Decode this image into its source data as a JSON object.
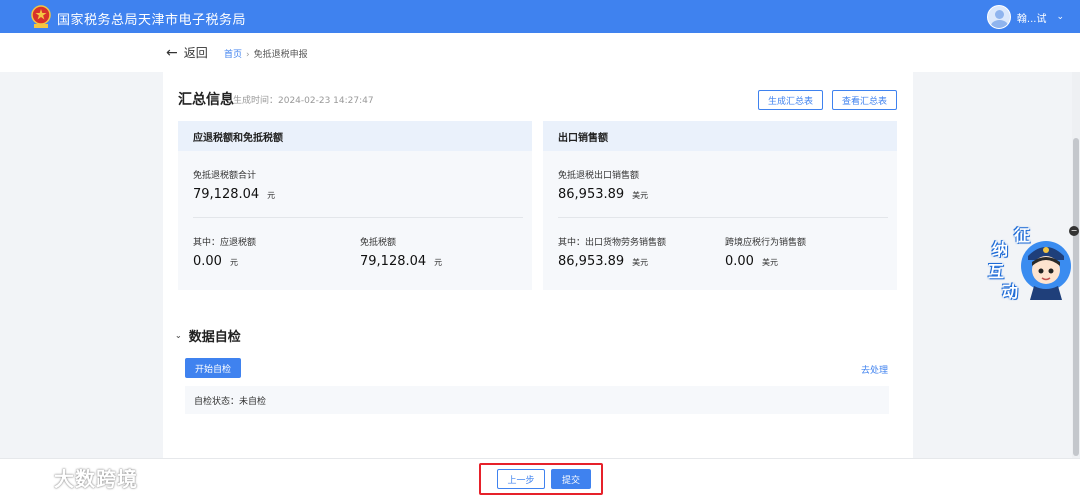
{
  "header": {
    "title": "国家税务总局天津市电子税务局",
    "user_name": "翰...试",
    "caret": "⌄"
  },
  "breadcrumb": {
    "back_label": "返回",
    "back_icon": "←",
    "home": "首页",
    "separator": "›",
    "current": "免抵退税申报"
  },
  "summary": {
    "title": "汇总信息",
    "generated_time": "生成时间：2024-02-23 14:27:47",
    "generate_button": "生成汇总表",
    "view_button": "查看汇总表",
    "left_card": {
      "title": "应退税额和免抵税额",
      "total_label": "免抵退税额合计",
      "total_value": "79,128.04",
      "total_unit": "元",
      "refund_label": "其中：应退税额",
      "refund_value": "0.00",
      "refund_unit": "元",
      "exempt_label": "免抵税额",
      "exempt_value": "79,128.04",
      "exempt_unit": "元"
    },
    "right_card": {
      "title": "出口销售额",
      "total_label": "免抵退税出口销售额",
      "total_value": "86,953.89",
      "total_unit": "美元",
      "goods_label": "其中：出口货物劳务销售额",
      "goods_value": "86,953.89",
      "goods_unit": "美元",
      "crossborder_label": "跨境应税行为销售额",
      "crossborder_value": "0.00",
      "crossborder_unit": "美元"
    }
  },
  "self_check": {
    "chevron": "⌄",
    "title": "数据自检",
    "start_button": "开始自检",
    "go_handle": "去处理",
    "status": "自检状态：未自检"
  },
  "widget": {
    "char1": "征",
    "char2": "纳",
    "char3": "互",
    "char4": "动",
    "close": "−"
  },
  "footer": {
    "prev_button": "上一步",
    "submit_button": "提交",
    "watermark": "大数跨境"
  },
  "colors": {
    "primary": "#3f82ef",
    "highlight": "#e6212a",
    "card_head": "#eaf1fb"
  }
}
